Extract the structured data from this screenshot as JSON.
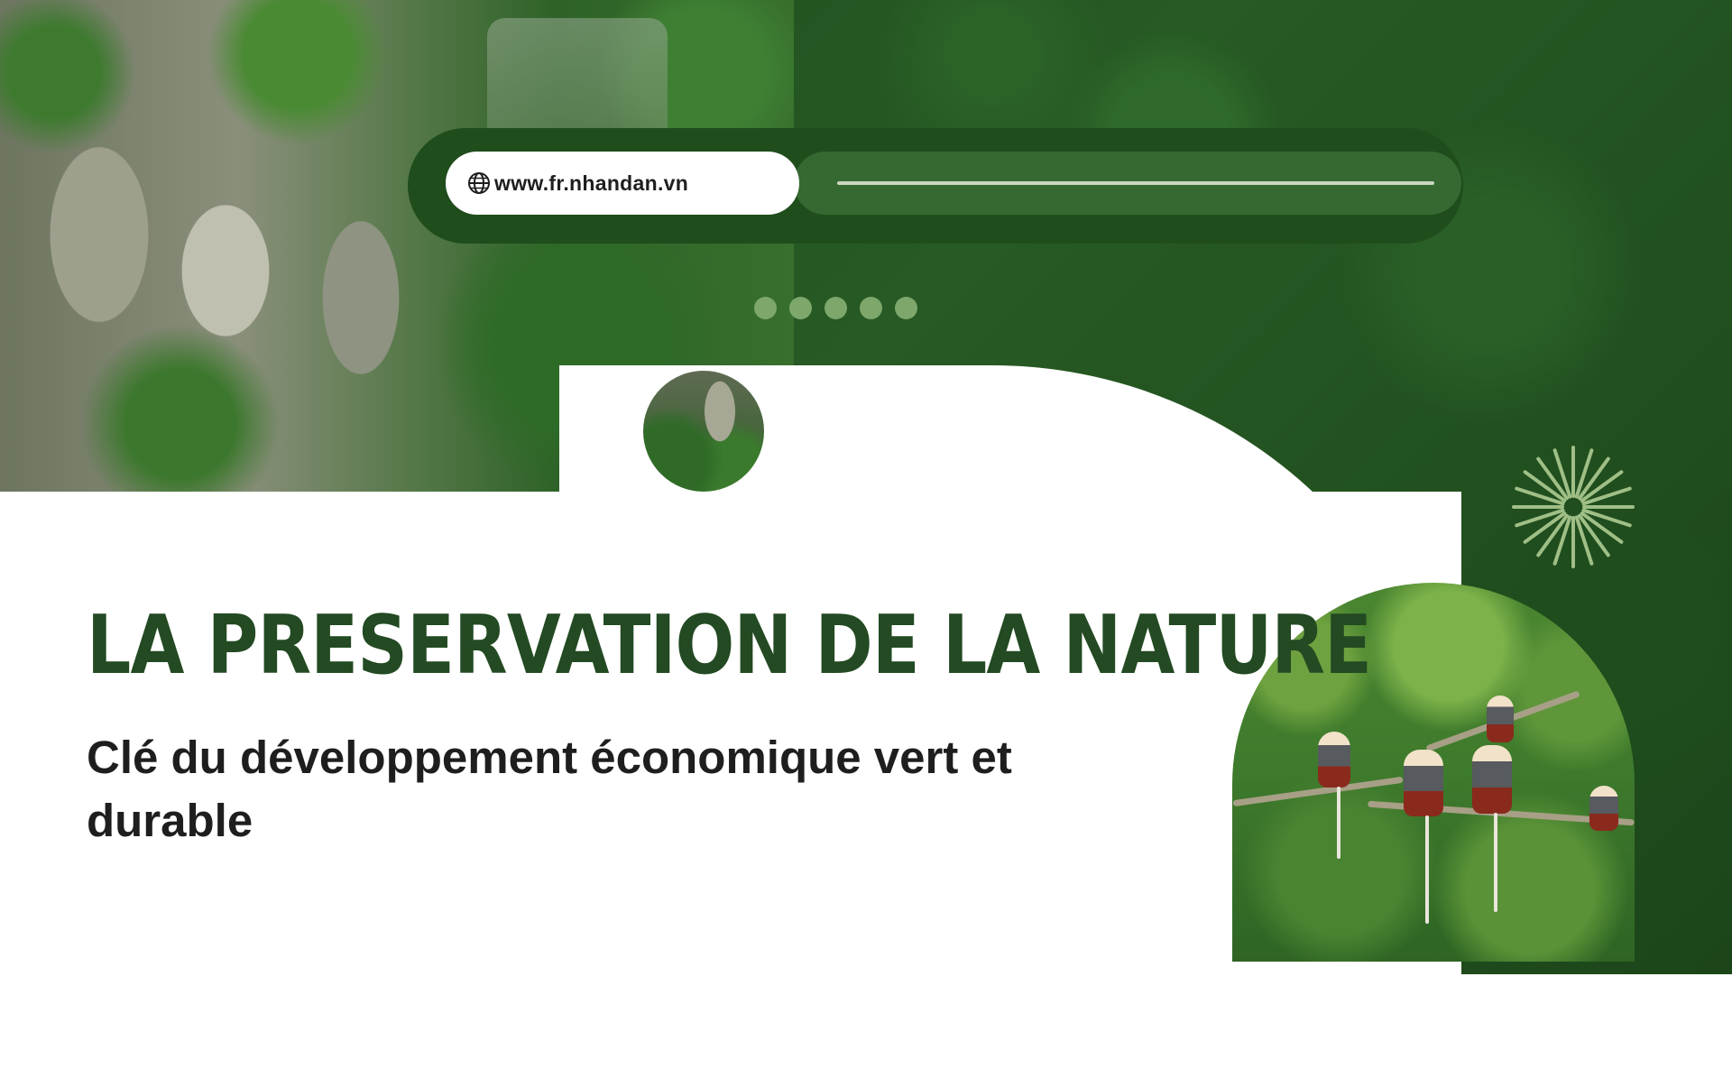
{
  "header": {
    "url": "www.fr.nhandan.vn",
    "url_icon": "globe-icon",
    "pager_dots": 5
  },
  "hero": {
    "title": "LA PRESERVATION DE LA NATURE",
    "subtitle": "Clé du développement économique vert et durable"
  },
  "colors": {
    "forest_dark": "#1e4a1c",
    "title_green": "#234a22",
    "dot_green": "#7ea86b",
    "subtitle_dark": "#1e1e1e"
  },
  "decorations": {
    "burst_icon": "sunburst-icon",
    "images": [
      "cliff-forest-photo",
      "round-cliff-photo",
      "monkeys-in-trees-photo"
    ]
  }
}
